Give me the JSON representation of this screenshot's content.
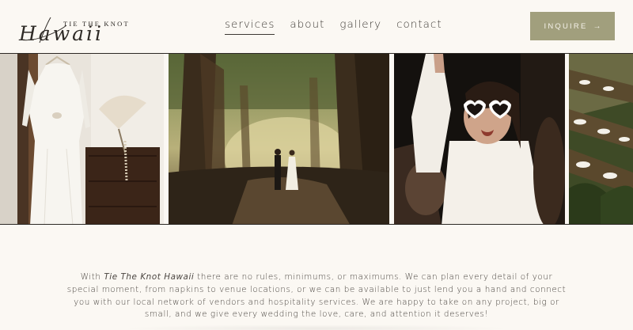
{
  "brand": {
    "tagline": "TIE THE KNOT",
    "script_name": "Hawaii"
  },
  "nav": {
    "items": [
      {
        "label": "services",
        "active": true
      },
      {
        "label": "about",
        "active": false
      },
      {
        "label": "gallery",
        "active": false
      },
      {
        "label": "contact",
        "active": false
      }
    ]
  },
  "cta": {
    "label": "INQUIRE",
    "icon": "arrow-right-icon",
    "icon_glyph": "→",
    "color": "#a19f7d"
  },
  "gallery": {
    "photos": [
      {
        "subject": "white-wedding-dress-on-hanger"
      },
      {
        "subject": "couple-walking-under-banyan-trees"
      },
      {
        "subject": "guest-dancing-heart-sunglasses"
      },
      {
        "subject": "reception-tables-outdoors"
      }
    ]
  },
  "intro": {
    "prefix": "With ",
    "brand_italic": "Tie The Knot Hawaii",
    "body": " there are no rules, minimums, or maximums. We can plan every detail of your special moment, from napkins to venue locations, or we can be available to just lend you a hand and connect you with our local network of vendors and hospitality services. We are happy to take on any project, big or small, and we give every wedding the love, care, and attention it deserves!"
  },
  "colors": {
    "background": "#fbf8f3",
    "text": "#3a3631",
    "accent": "#a19f7d"
  }
}
